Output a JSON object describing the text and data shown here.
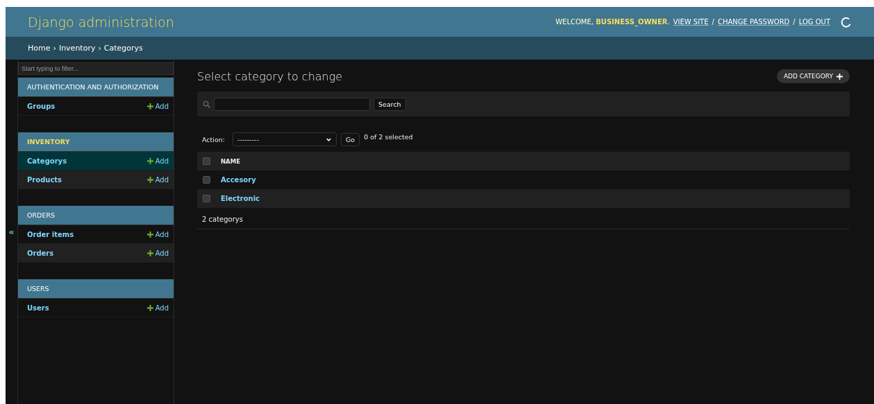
{
  "header": {
    "site_name": "Django administration",
    "welcome": "WELCOME, **BUSINESS_OWNER**.",
    "links": [
      "VIEW SITE",
      "CHANGE PASSWORD",
      "LOG OUT"
    ],
    "separator": "/"
  },
  "breadcrumbs": {
    "items": [
      "Home",
      "Inventory",
      "Categorys"
    ],
    "separator": "›"
  },
  "sidebar": {
    "filter": {
      "placeholder": "Start typing to filter..."
    },
    "toggle": "«",
    "apps": [
      {
        "name": "AUTHENTICATION AND AUTHORIZATION",
        "selected": false,
        "models": [
          {
            "name": "Groups",
            "add": "Add",
            "selected": false
          }
        ]
      },
      {
        "name": "INVENTORY",
        "selected": true,
        "models": [
          {
            "name": "Categorys",
            "add": "Add",
            "selected": true
          },
          {
            "name": "Products",
            "add": "Add",
            "selected": false
          }
        ]
      },
      {
        "name": "ORDERS",
        "selected": false,
        "models": [
          {
            "name": "Order items",
            "add": "Add",
            "selected": false
          },
          {
            "name": "Orders",
            "add": "Add",
            "selected": false
          }
        ]
      },
      {
        "name": "USERS",
        "selected": false,
        "models": [
          {
            "name": "Users",
            "add": "Add",
            "selected": false
          }
        ]
      }
    ]
  },
  "content": {
    "title": "Select category to change",
    "add_button": "ADD CATEGORY",
    "search_button": "Search",
    "actions": {
      "label": "Action:",
      "select_value": "---------",
      "go": "Go",
      "counter": "0 of 2 selected"
    },
    "table": {
      "columns": [
        {
          "label": "NAME",
          "checked": false
        }
      ],
      "rows": [
        {
          "name": "Accesory",
          "checked": false
        },
        {
          "name": "Electronic",
          "checked": false
        }
      ]
    },
    "result_count": "2 categorys"
  }
}
